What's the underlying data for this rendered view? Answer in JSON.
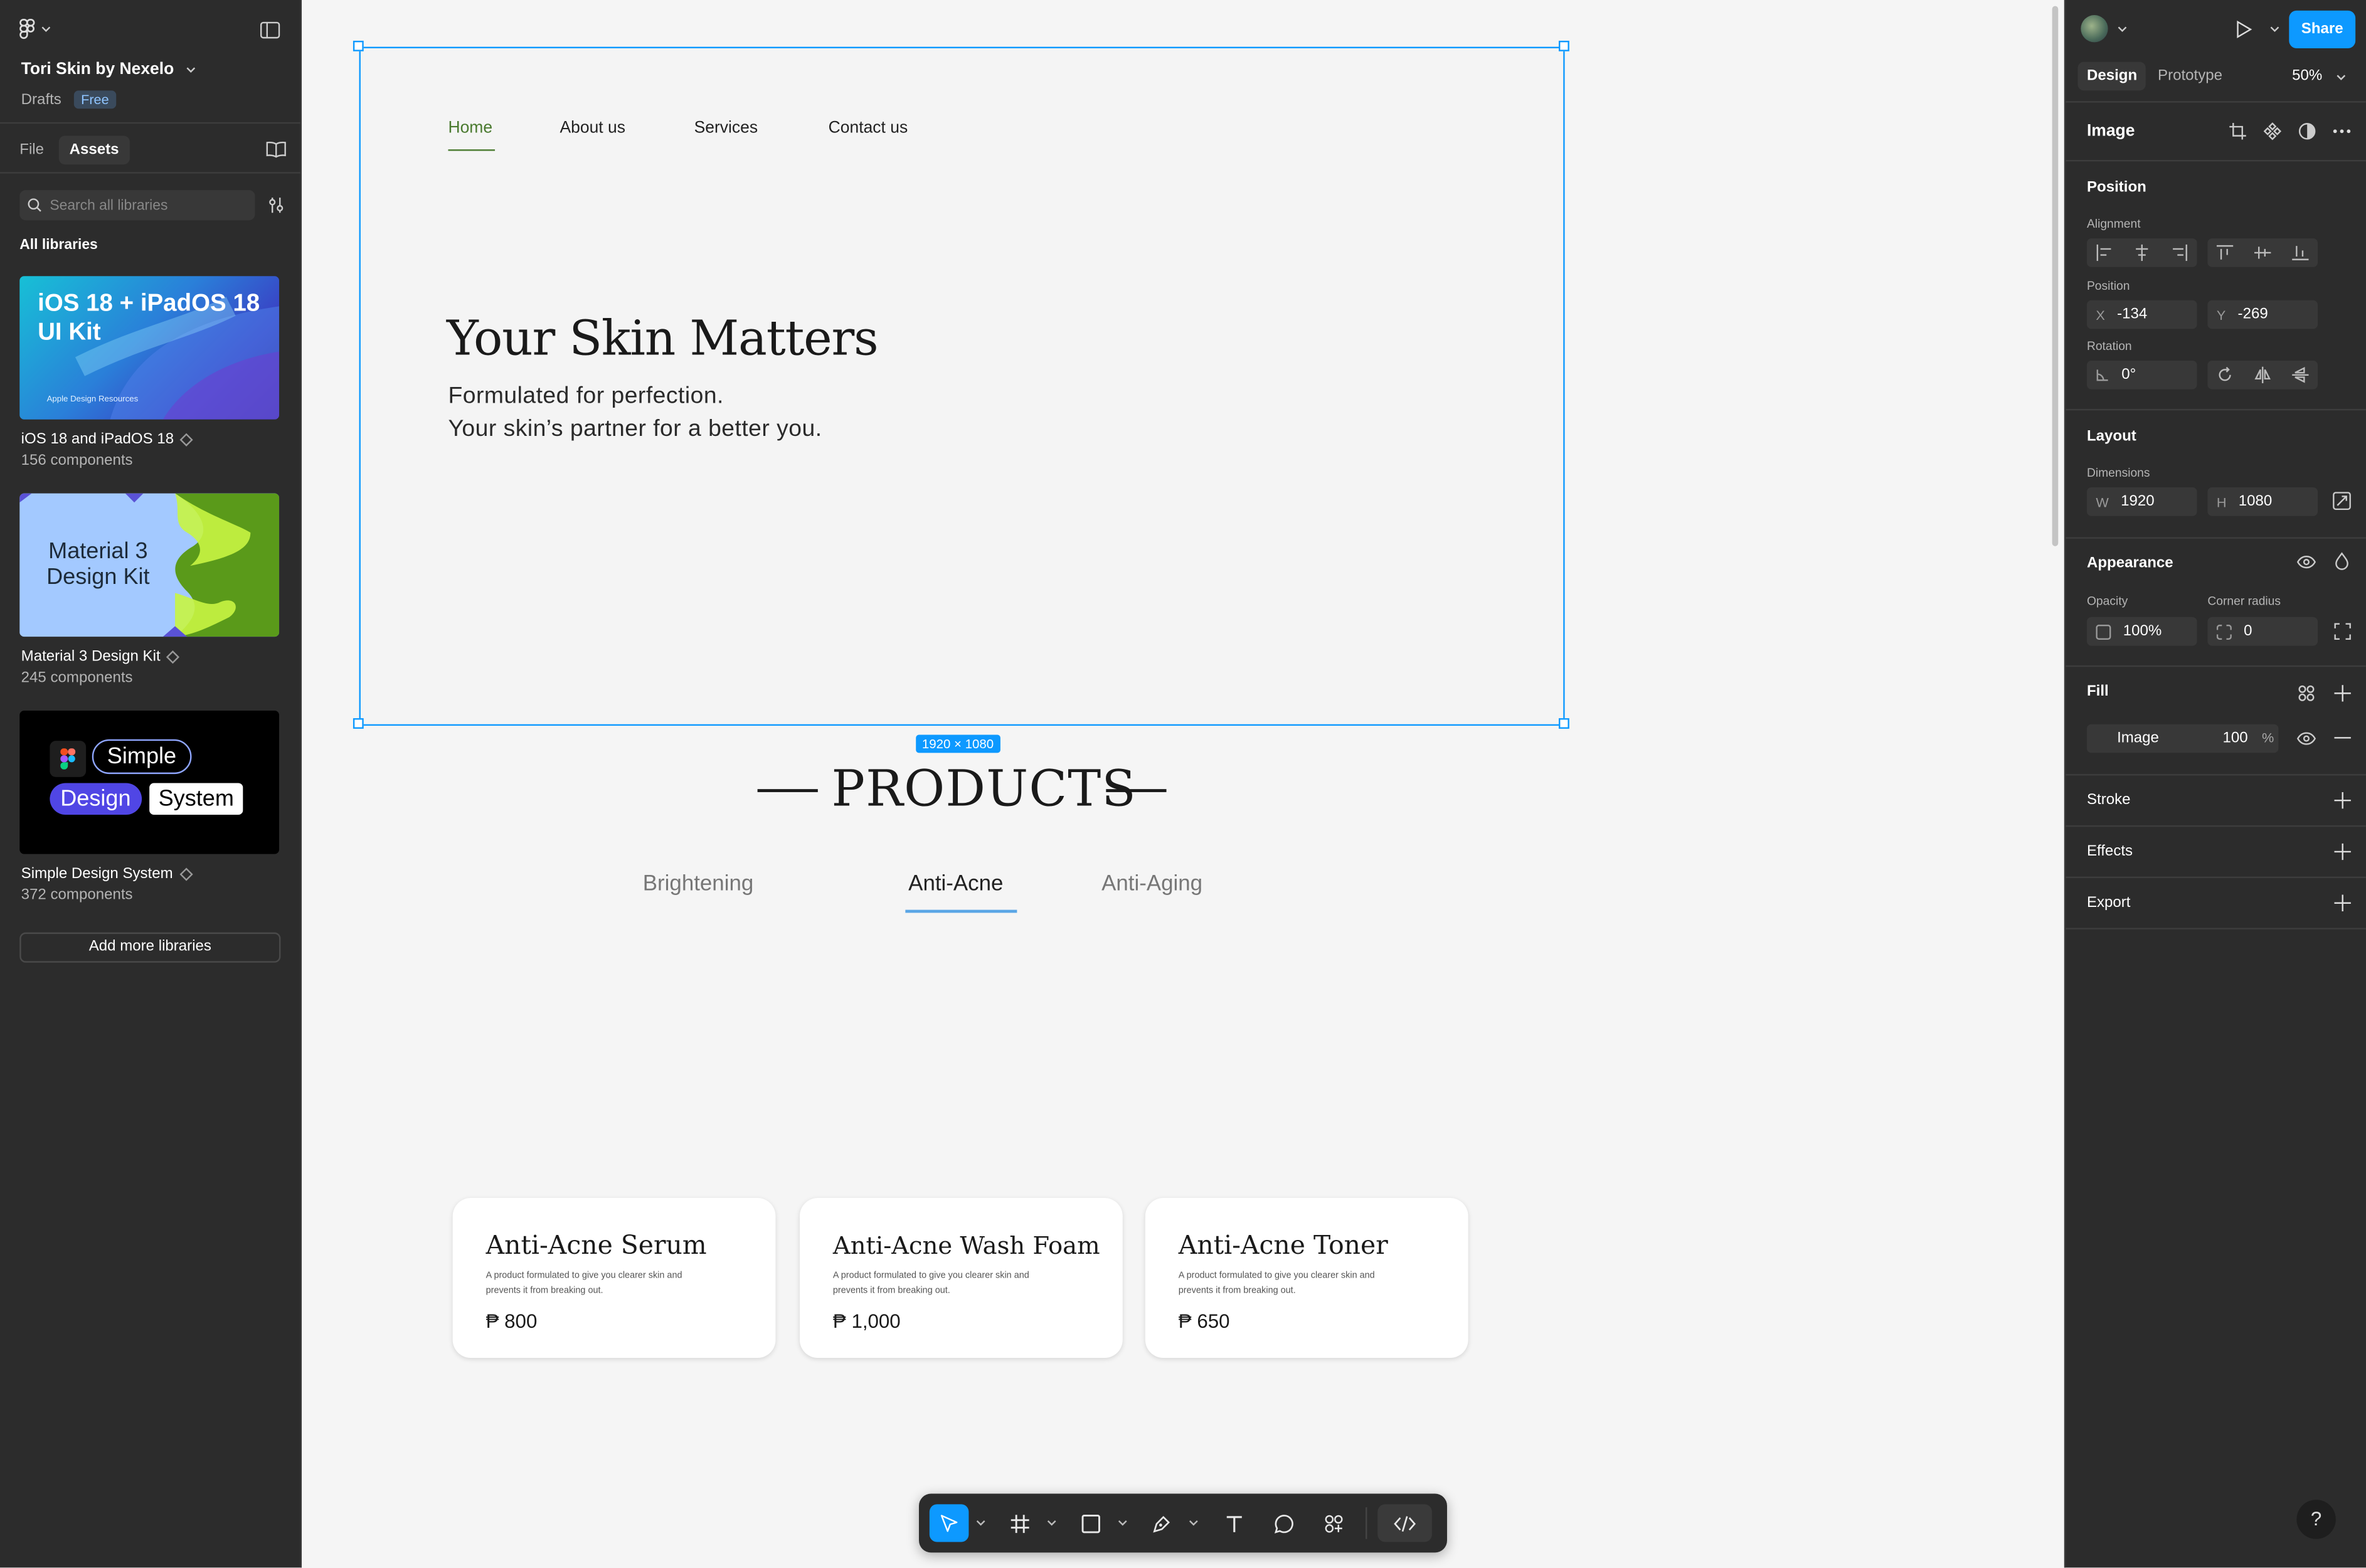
{
  "file": {
    "name": "Tori Skin by Nexelo",
    "location": "Drafts",
    "plan_badge": "Free"
  },
  "left_panel": {
    "tabs": [
      "File",
      "Assets"
    ],
    "search_placeholder": "Search all libraries",
    "section_title": "All libraries",
    "libraries": [
      {
        "name": "iOS 18 and iPadOS 18",
        "count": "156 components",
        "thumb_title": "iOS 18 + iPadOS 18 UI Kit",
        "thumb_sub": "Apple Design Resources"
      },
      {
        "name": "Material 3 Design Kit",
        "count": "245 components",
        "thumb_title_line1": "Material 3",
        "thumb_title_line2": "Design Kit"
      },
      {
        "name": "Simple Design System",
        "count": "372 components",
        "thumb_words": [
          "Simple",
          "Design",
          "System"
        ]
      }
    ],
    "add_button": "Add more libraries"
  },
  "canvas": {
    "nav": [
      "Home",
      "About us",
      "Services",
      "Contact us"
    ],
    "hero_title": "Your Skin Matters",
    "hero_line1": "Formulated for perfection.",
    "hero_line2": "Your skin’s partner for a better you.",
    "selection_size": "1920 × 1080",
    "products_heading": "PRODUCTS",
    "product_tabs": [
      "Brightening",
      "Anti-Acne",
      "Anti-Aging"
    ],
    "active_tab": "Anti-Acne",
    "cards": [
      {
        "title": "Anti-Acne Serum",
        "desc": "A product formulated to give you clearer skin and prevents it from breaking out.",
        "price": "₱ 800"
      },
      {
        "title": "Anti-Acne Wash Foam",
        "desc": "A product formulated to give you clearer skin and prevents it from breaking out.",
        "price": "₱ 1,000"
      },
      {
        "title": "Anti-Acne Toner",
        "desc": "A product formulated to give you clearer skin and prevents it from breaking out.",
        "price": "₱ 650"
      }
    ]
  },
  "right_panel": {
    "share_label": "Share",
    "tabs": [
      "Design",
      "Prototype"
    ],
    "zoom": "50%",
    "layer_type": "Image",
    "position": {
      "title": "Position",
      "alignment_label": "Alignment",
      "position_label": "Position",
      "x": "-134",
      "y": "-269",
      "rotation_label": "Rotation",
      "rotation": "0°"
    },
    "layout": {
      "title": "Layout",
      "dimensions_label": "Dimensions",
      "w": "1920",
      "h": "1080"
    },
    "appearance": {
      "title": "Appearance",
      "opacity_label": "Opacity",
      "opacity": "100%",
      "radius_label": "Corner radius",
      "radius": "0"
    },
    "fill": {
      "title": "Fill",
      "type": "Image",
      "opacity": "100",
      "unit": "%"
    },
    "sections": [
      "Stroke",
      "Effects",
      "Export"
    ],
    "help": "?"
  },
  "colors": {
    "accent": "#0d99ff",
    "nav_active": "#4a7a2f",
    "panel": "#2c2c2c",
    "canvas": "#f5f5f5"
  }
}
